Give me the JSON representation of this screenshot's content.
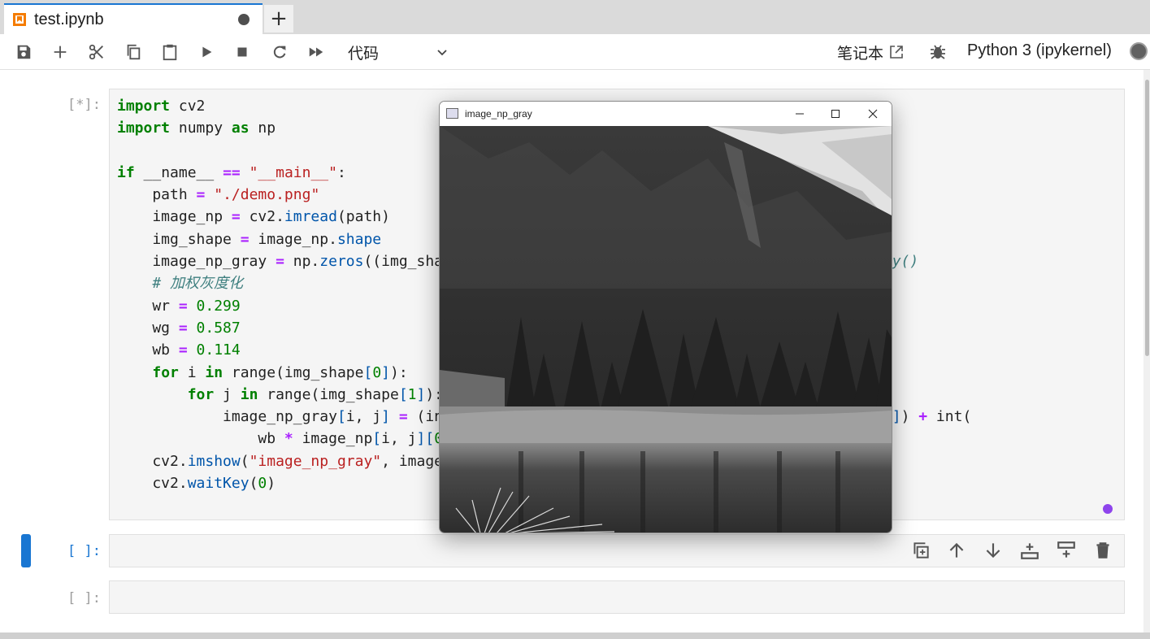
{
  "tab": {
    "title": "test.ipynb"
  },
  "toolbar": {
    "cell_type": "代码",
    "notebook_label": "笔记本",
    "kernel_name": "Python 3 (ipykernel)"
  },
  "cells": [
    {
      "prompt": "[*]:"
    },
    {
      "prompt": "[ ]:"
    },
    {
      "prompt": "[ ]:"
    }
  ],
  "image_window": {
    "title": "image_np_gray"
  },
  "colors": {
    "accent": "#1976d2",
    "busy": "#8e44ec"
  }
}
